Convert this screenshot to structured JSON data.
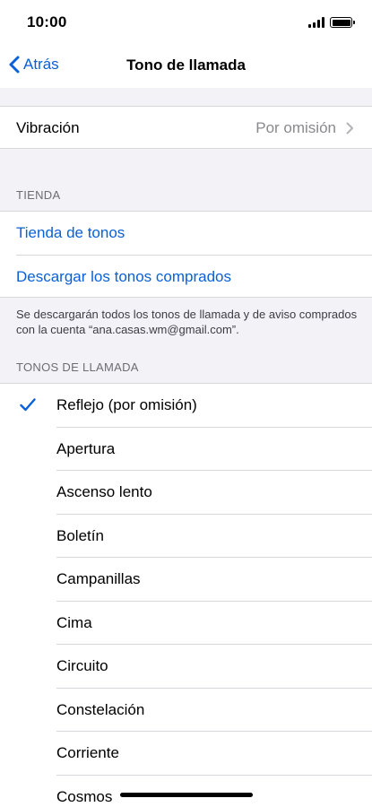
{
  "status_bar": {
    "time": "10:00"
  },
  "nav": {
    "back_label": "Atrás",
    "title": "Tono de llamada"
  },
  "vibration": {
    "label": "Vibración",
    "value": "Por omisión"
  },
  "store": {
    "header": "TIENDA",
    "tone_store": "Tienda de tonos",
    "download_purchased": "Descargar los tonos comprados",
    "note": "Se descargarán todos los tonos de llamada y de aviso comprados con la cuenta “ana.casas.wm@gmail.com”."
  },
  "ringtones": {
    "header": "TONOS DE LLAMADA",
    "selected_index": 0,
    "items": [
      "Reflejo (por omisión)",
      "Apertura",
      "Ascenso lento",
      "Boletín",
      "Campanillas",
      "Cima",
      "Circuito",
      "Constelación",
      "Corriente",
      "Cosmos"
    ]
  },
  "colors": {
    "accent": "#0a60d8",
    "background": "#f2f2f7",
    "separator": "#d8d8dc"
  }
}
